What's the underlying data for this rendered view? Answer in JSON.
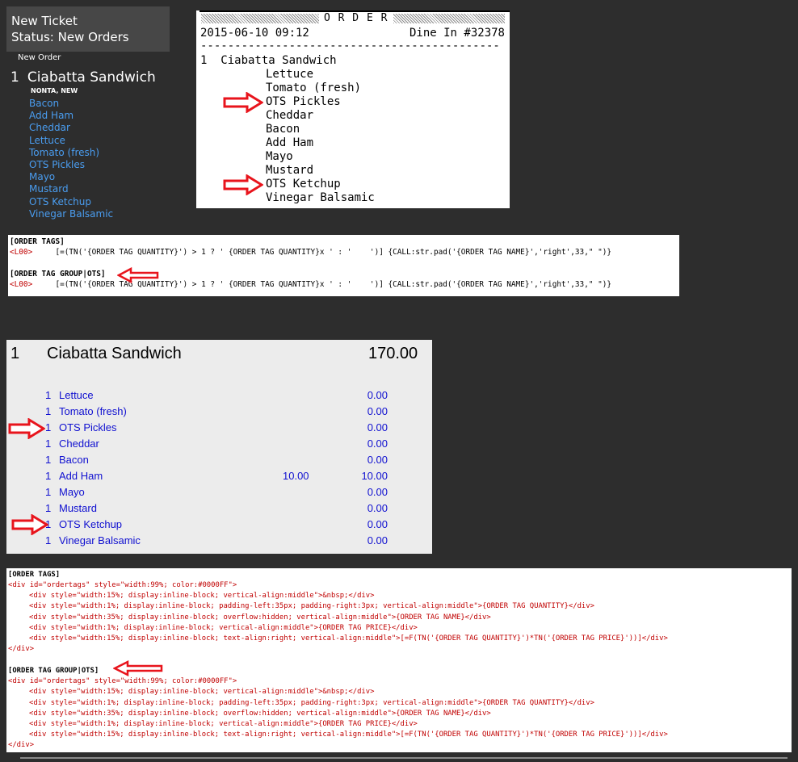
{
  "ticket": {
    "title": "New Ticket",
    "status": "Status: New Orders",
    "group_label": "New Order",
    "item_qty": "1",
    "item_name": "Ciabatta Sandwich",
    "item_note": "NONTA, NEW",
    "modifiers": [
      "Bacon",
      "Add Ham",
      "Cheddar",
      "Lettuce",
      "Tomato (fresh)",
      "OTS Pickles",
      "Mayo",
      "Mustard",
      "OTS Ketchup",
      "Vinegar Balsamic"
    ]
  },
  "receipt": {
    "title": "O R D E R",
    "datetime": "2015-06-10 09:12",
    "table": "Dine In #32378",
    "separator": "--------------------------------------------",
    "item_line": "1  Ciabatta Sandwich",
    "modifiers": [
      "Lettuce",
      "Tomato (fresh)",
      "OTS Pickles",
      "Cheddar",
      "Bacon",
      "Add Ham",
      "Mayo",
      "Mustard",
      "OTS Ketchup",
      "Vinegar Balsamic"
    ]
  },
  "template_printer": {
    "header1": "[ORDER TAGS]",
    "tag1": "<L00>",
    "expr1": "[=(TN('{ORDER TAG QUANTITY}') > 1 ? ' {ORDER TAG QUANTITY}x ' : '    ')] {CALL:str.pad('{ORDER TAG NAME}','right',33,\" \")}",
    "header2": "[ORDER TAG GROUP|OTS]",
    "tag2": "<L00>",
    "expr2": "[=(TN('{ORDER TAG QUANTITY}') > 1 ? ' {ORDER TAG QUANTITY}x ' : '    ')] {CALL:str.pad('{ORDER TAG NAME}','right',33,\" \")}"
  },
  "screen_order": {
    "qty": "1",
    "name": "Ciabatta Sandwich",
    "price": "170.00",
    "rows": [
      {
        "qty": "1",
        "name": "Lettuce",
        "price": "",
        "total": "0.00"
      },
      {
        "qty": "1",
        "name": "Tomato (fresh)",
        "price": "",
        "total": "0.00"
      },
      {
        "qty": "1",
        "name": "OTS Pickles",
        "price": "",
        "total": "0.00"
      },
      {
        "qty": "1",
        "name": "Cheddar",
        "price": "",
        "total": "0.00"
      },
      {
        "qty": "1",
        "name": "Bacon",
        "price": "",
        "total": "0.00"
      },
      {
        "qty": "1",
        "name": "Add Ham",
        "price": "10.00",
        "total": "10.00"
      },
      {
        "qty": "1",
        "name": "Mayo",
        "price": "",
        "total": "0.00"
      },
      {
        "qty": "1",
        "name": "Mustard",
        "price": "",
        "total": "0.00"
      },
      {
        "qty": "1",
        "name": "OTS Ketchup",
        "price": "",
        "total": "0.00"
      },
      {
        "qty": "1",
        "name": "Vinegar Balsamic",
        "price": "",
        "total": "0.00"
      }
    ]
  },
  "template_html": {
    "header1": "[ORDER TAGS]",
    "block1": [
      "<div id=\"ordertags\" style=\"width:99%; color:#0000FF\">",
      "<div style=\"width:15%; display:inline-block; vertical-align:middle\">&nbsp;</div>",
      "<div style=\"width:1%; display:inline-block; padding-left:35px; padding-right:3px; vertical-align:middle\">{ORDER TAG QUANTITY}</div>",
      "<div style=\"width:35%; display:inline-block; overflow:hidden; vertical-align:middle\">{ORDER TAG NAME}</div>",
      "<div style=\"width:1%; display:inline-block; vertical-align:middle\">{ORDER TAG PRICE}</div>",
      "<div style=\"width:15%; display:inline-block; text-align:right; vertical-align:middle\">[=F(TN('{ORDER TAG QUANTITY}')*TN('{ORDER TAG PRICE}'))]</div>",
      "</div>"
    ],
    "header2": "[ORDER TAG GROUP|OTS]",
    "block2": [
      "<div id=\"ordertags\" style=\"width:99%; color:#0000FF\">",
      "<div style=\"width:15%; display:inline-block; vertical-align:middle\">&nbsp;</div>",
      "<div style=\"width:1%; display:inline-block; padding-left:35px; padding-right:3px; vertical-align:middle\">{ORDER TAG QUANTITY}</div>",
      "<div style=\"width:35%; display:inline-block; overflow:hidden; vertical-align:middle\">{ORDER TAG NAME}</div>",
      "<div style=\"width:1%; display:inline-block; vertical-align:middle\">{ORDER TAG PRICE}</div>",
      "<div style=\"width:15%; display:inline-block; text-align:right; vertical-align:middle\">[=F(TN('{ORDER TAG QUANTITY}')*TN('{ORDER TAG PRICE}'))]</div>",
      "</div>"
    ]
  },
  "colors": {
    "background": "#2d2d2d",
    "ticket_header": "#474747",
    "modifier_link": "#4a9df0",
    "order_tag_blue": "#1010d0",
    "code_tag_red": "#c00000",
    "arrow_red": "#e8141c"
  },
  "icons": [
    "red-arrow-icon"
  ]
}
